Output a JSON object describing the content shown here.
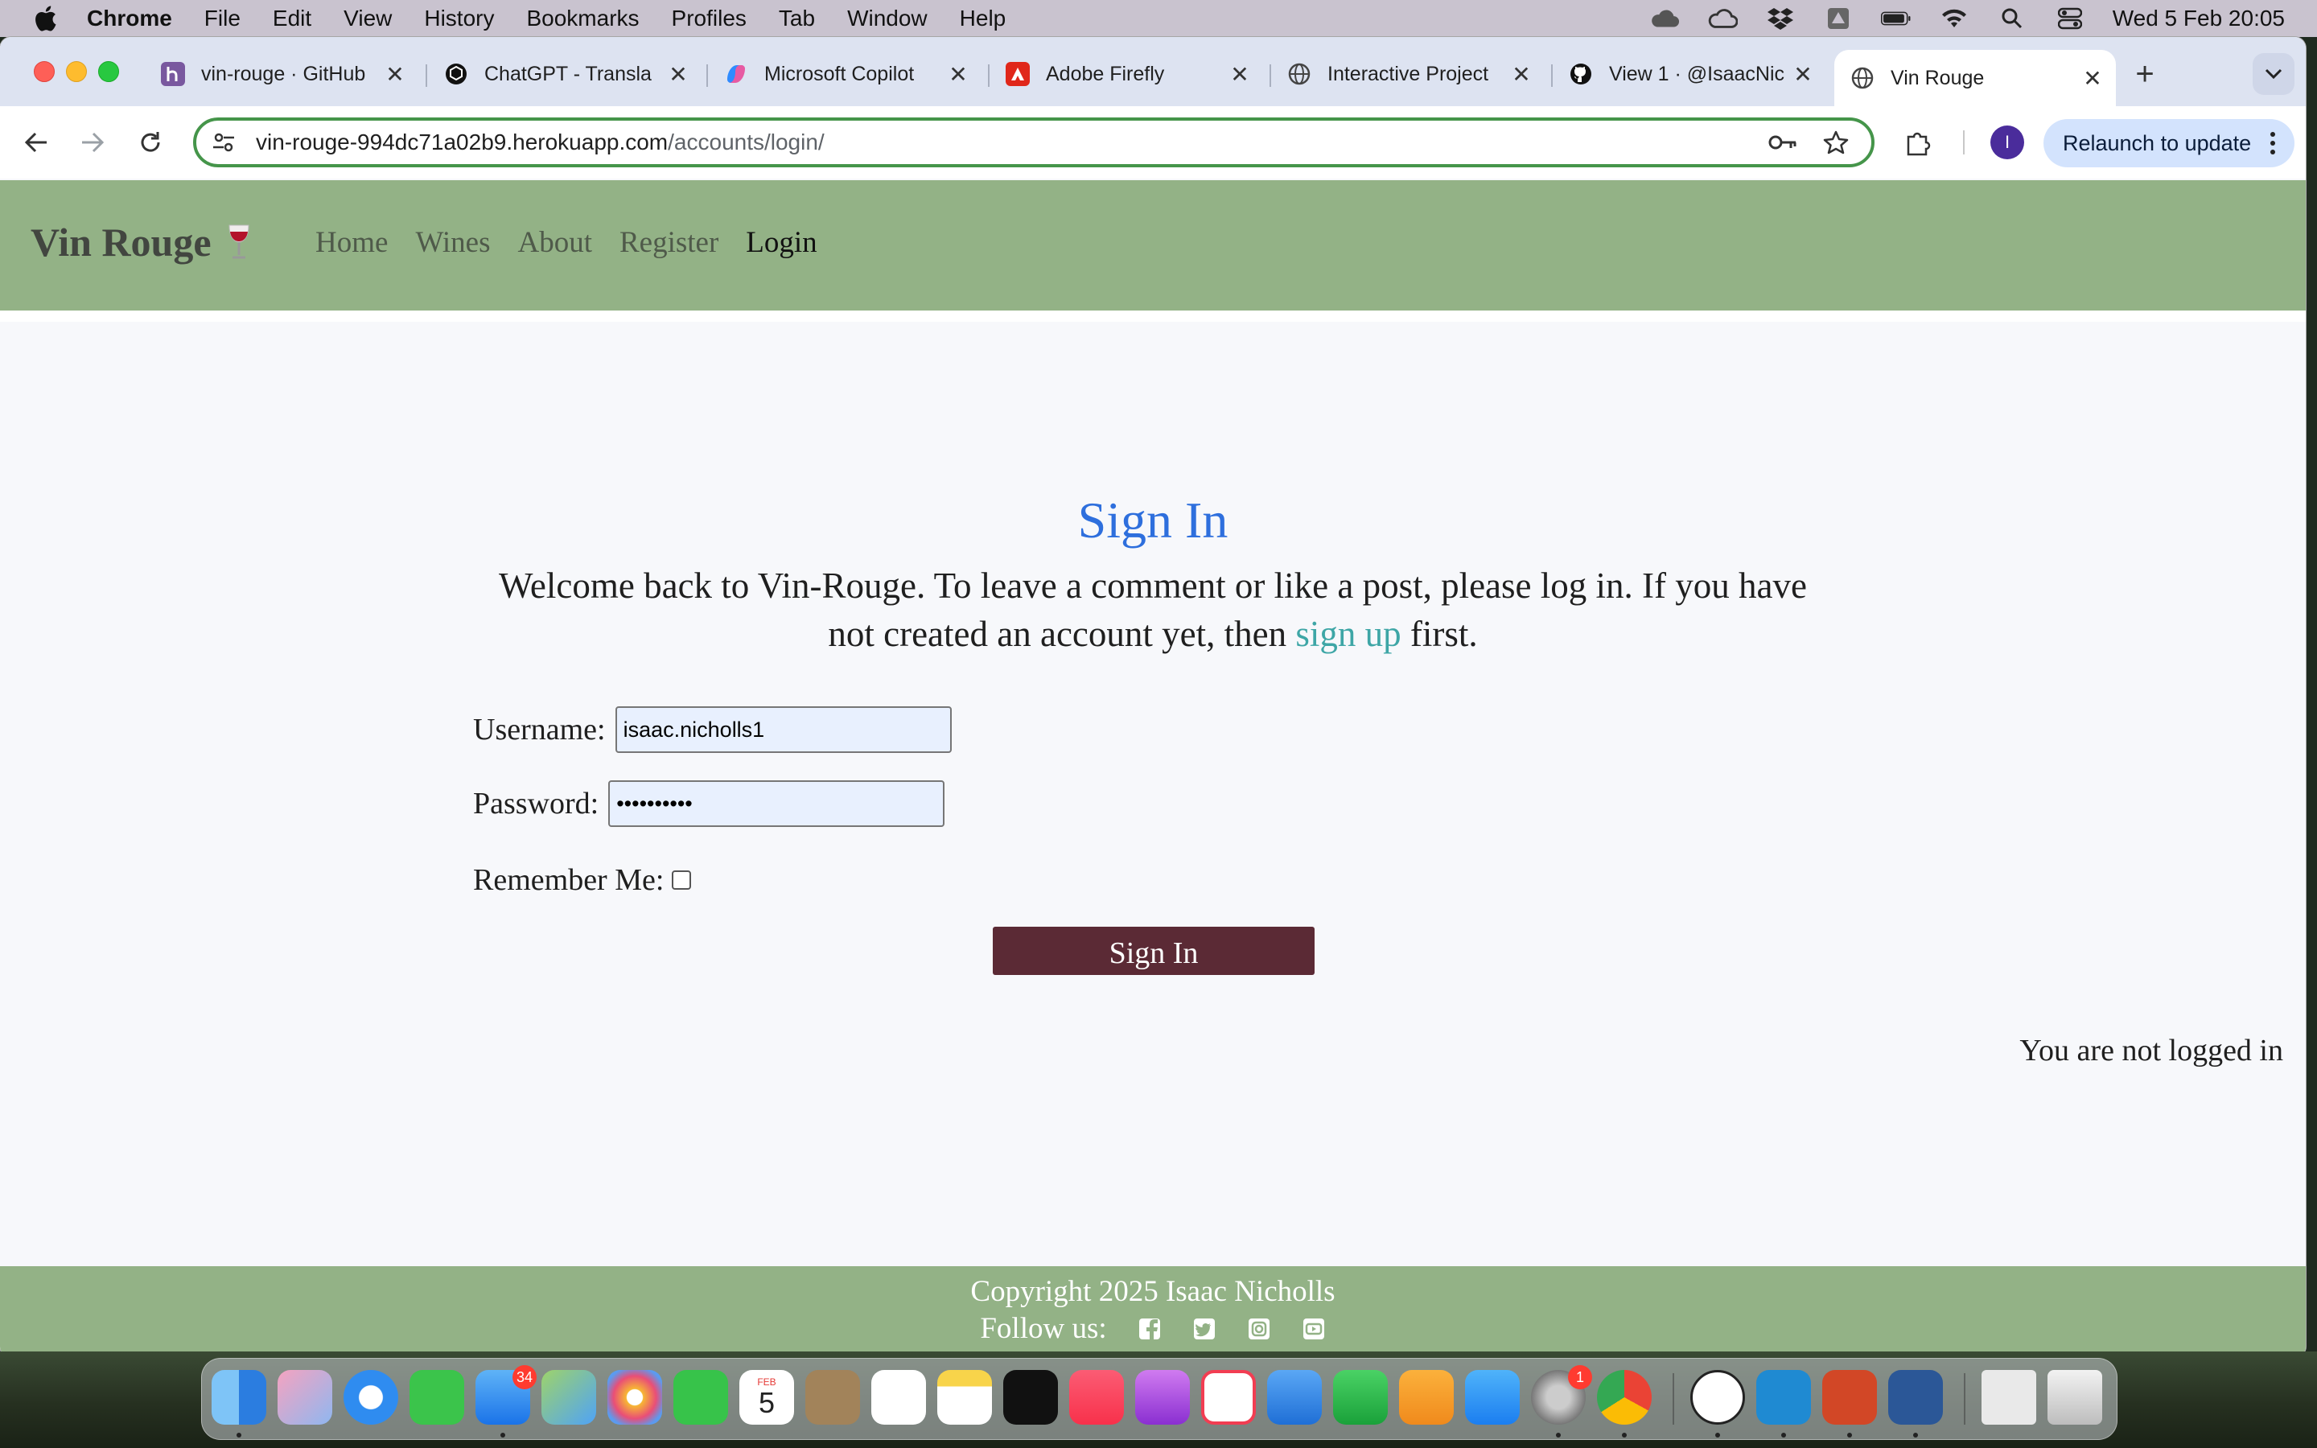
{
  "menubar": {
    "app_name": "Chrome",
    "items": [
      "File",
      "Edit",
      "View",
      "History",
      "Bookmarks",
      "Profiles",
      "Tab",
      "Window",
      "Help"
    ],
    "clock": "Wed 5 Feb  20:05"
  },
  "tabs": [
    {
      "title": "vin-rouge · GitHub",
      "favicon": "heroku-icon",
      "color": "#79589f"
    },
    {
      "title": "ChatGPT - Transla",
      "favicon": "chatgpt-icon",
      "color": "#111111"
    },
    {
      "title": "Microsoft Copilot",
      "favicon": "copilot-icon",
      "color": "#2f8bff"
    },
    {
      "title": "Adobe Firefly",
      "favicon": "adobe-icon",
      "color": "#e0271a"
    },
    {
      "title": "Interactive Project",
      "favicon": "globe-icon",
      "color": "#444444"
    },
    {
      "title": "View 1 · @IsaacNic",
      "favicon": "github-icon",
      "color": "#111111"
    },
    {
      "title": "Vin Rouge",
      "favicon": "globe-icon",
      "color": "#444444",
      "active": true
    }
  ],
  "toolbar": {
    "url_host": "vin-rouge-994dc71a02b9.herokuapp.com",
    "url_path": "/accounts/login/",
    "profile_initial": "I",
    "relaunch_label": "Relaunch to update"
  },
  "site": {
    "brand": "Vin Rouge",
    "nav": [
      "Home",
      "Wines",
      "About",
      "Register",
      "Login"
    ],
    "current_nav": "Login"
  },
  "signin": {
    "title": "Sign In",
    "intro_before": "Welcome back to Vin-Rouge. To leave a comment or like a post, please log in. If you have not created an account yet, then ",
    "intro_link": "sign up",
    "intro_after": " first.",
    "username_label": "Username:",
    "username_value": "isaac.nicholls1",
    "password_label": "Password:",
    "password_value": "••••••••••",
    "remember_label": "Remember Me:",
    "submit_label": "Sign In",
    "status": "You are not logged in"
  },
  "footer": {
    "copyright": "Copyright 2025 Isaac Nicholls",
    "follow_label": "Follow us:",
    "social": [
      "facebook-icon",
      "twitter-icon",
      "instagram-icon",
      "youtube-icon"
    ]
  },
  "dock": {
    "mail_badge": "34",
    "settings_badge": "1",
    "calendar_month": "FEB",
    "calendar_day": "5"
  },
  "colors": {
    "nav_green": "#93b286",
    "title_blue": "#2e6fdd",
    "link_teal": "#3ea6a6",
    "button_wine": "#5b2a35"
  }
}
